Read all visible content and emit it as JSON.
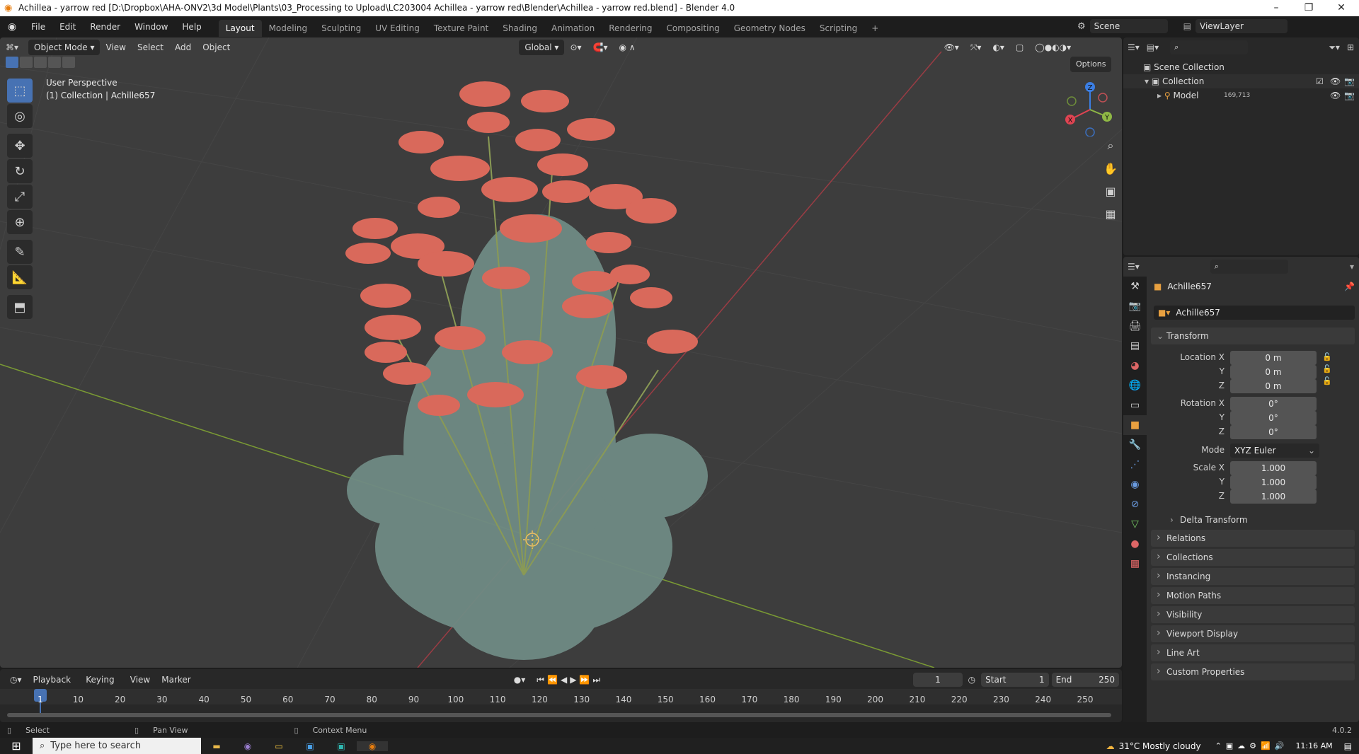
{
  "window": {
    "title": "Achillea - yarrow red [D:\\Dropbox\\AHA-ONV2\\3d Model\\Plants\\03_Processing to Upload\\LC203004 Achillea - yarrow red\\Blender\\Achillea - yarrow red.blend] - Blender 4.0",
    "controls": [
      "–",
      "❐",
      "✕"
    ]
  },
  "menu": {
    "items": [
      "File",
      "Edit",
      "Render",
      "Window",
      "Help"
    ]
  },
  "workspaces": [
    "Layout",
    "Modeling",
    "Sculpting",
    "UV Editing",
    "Texture Paint",
    "Shading",
    "Animation",
    "Rendering",
    "Compositing",
    "Geometry Nodes",
    "Scripting"
  ],
  "workspace_add": "+",
  "scene": {
    "label": "Scene",
    "view_layer": "ViewLayer"
  },
  "viewport_header": {
    "mode": "Object Mode",
    "menus": [
      "View",
      "Select",
      "Add",
      "Object"
    ],
    "orientation": "Global",
    "options": "Options"
  },
  "viewport": {
    "perspective": "User Perspective",
    "collection_info": "(1) Collection | Achille657",
    "axis_labels": {
      "x": "X",
      "y": "Y",
      "z": "Z"
    }
  },
  "outliner": {
    "scene_collection": "Scene Collection",
    "collection": "Collection",
    "model": "Model",
    "model_badge": "169,713"
  },
  "properties": {
    "object_name": "Achille657",
    "data_name": "Achille657",
    "transform": {
      "header": "Transform",
      "location_label": "Location X",
      "location": [
        "0 m",
        "0 m",
        "0 m"
      ],
      "rotation_label": "Rotation X",
      "rotation": [
        "0°",
        "0°",
        "0°"
      ],
      "mode_label": "Mode",
      "mode_value": "XYZ Euler",
      "scale_label": "Scale X",
      "scale": [
        "1.000",
        "1.000",
        "1.000"
      ],
      "y_label": "Y",
      "z_label": "Z",
      "delta": "Delta Transform"
    },
    "panels": [
      "Relations",
      "Collections",
      "Instancing",
      "Motion Paths",
      "Visibility",
      "Viewport Display",
      "Line Art",
      "Custom Properties"
    ]
  },
  "timeline": {
    "menus": [
      "Playback",
      "Keying",
      "View",
      "Marker"
    ],
    "current_frame": "1",
    "start_label": "Start",
    "start": "1",
    "end_label": "End",
    "end": "250",
    "ticks": [
      "1",
      "10",
      "20",
      "30",
      "40",
      "50",
      "60",
      "70",
      "80",
      "90",
      "100",
      "110",
      "120",
      "130",
      "140",
      "150",
      "160",
      "170",
      "180",
      "190",
      "200",
      "210",
      "220",
      "230",
      "240",
      "250"
    ]
  },
  "statusbar": {
    "select": "Select",
    "pan": "Pan View",
    "context": "Context Menu",
    "version": "4.0.2"
  },
  "taskbar": {
    "search_placeholder": "Type here to search",
    "weather": "31°C  Mostly cloudy",
    "time": "11:16 AM"
  },
  "colors": {
    "accent": "#4772b3",
    "x_axis": "#e04452",
    "y_axis": "#8fb845",
    "z_axis": "#3b7ee3",
    "flower": "#d9695b",
    "foliage": "#6f8a84"
  }
}
